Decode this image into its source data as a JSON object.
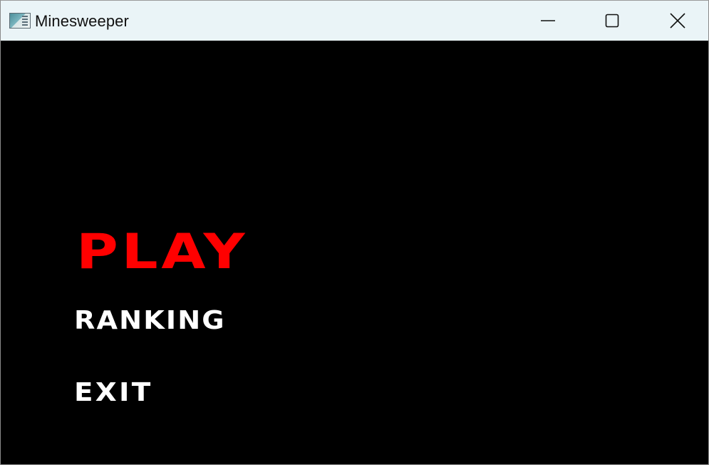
{
  "window": {
    "title": "Minesweeper",
    "icon": "minesweeper-app-icon",
    "controls": {
      "minimize_icon": "minimize-icon",
      "maximize_icon": "maximize-icon",
      "close_icon": "close-icon"
    }
  },
  "menu": {
    "play": {
      "label": "PLAY",
      "color": "#ff0000"
    },
    "ranking": {
      "label": "RANKING",
      "color": "#ffffff"
    },
    "exit": {
      "label": "EXIT",
      "color": "#ffffff"
    }
  },
  "colors": {
    "background": "#000000",
    "titlebar": "#eaf4f7"
  }
}
